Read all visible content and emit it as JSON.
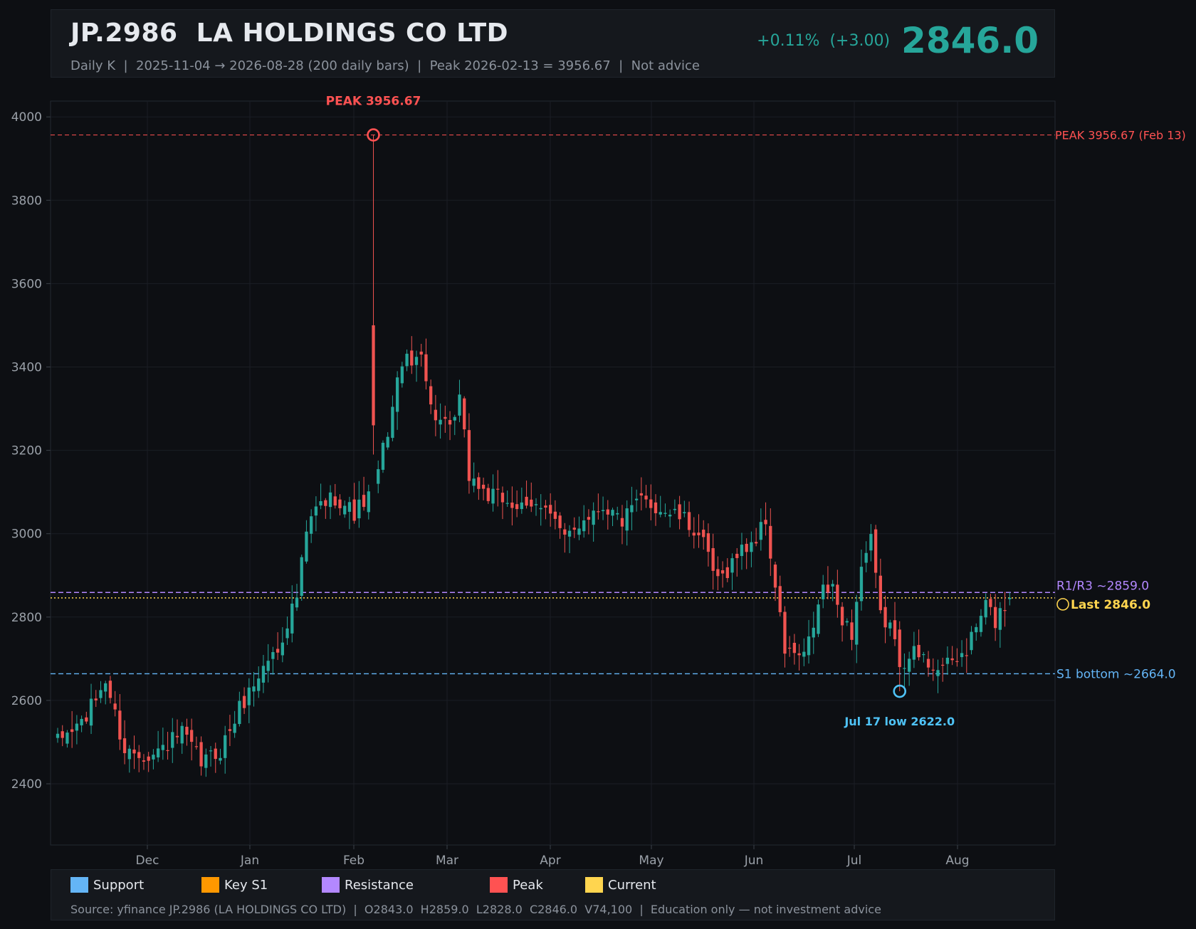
{
  "header": {
    "title": "JP.2986  LA HOLDINGS CO LTD",
    "subtitle": "Daily K  |  2025-11-04 → 2026-08-28 (200 daily bars)  |  Peak 2026-02-13 = 3956.67  |  Not advice",
    "change": "+0.11%  (+3.00)",
    "last_price": "2846.0"
  },
  "colors": {
    "up": "#26a69a",
    "down": "#ef5350",
    "peak": "#ff5252",
    "support": "#64b5f6",
    "key_s1": "#ff9800",
    "resistance": "#b388ff",
    "current": "#ffd54f",
    "low_marker": "#4fc3f7"
  },
  "legend": [
    {
      "label": "Support",
      "color": "#64b5f6"
    },
    {
      "label": "Key S1",
      "color": "#ff9800"
    },
    {
      "label": "Resistance",
      "color": "#b388ff"
    },
    {
      "label": "Peak",
      "color": "#ff5252"
    },
    {
      "label": "Current",
      "color": "#ffd54f"
    }
  ],
  "source": "Source: yfinance JP.2986 (LA HOLDINGS CO LTD)  |  O2843.0  H2859.0  L2828.0  C2846.0  V74,100  |  Education only — not investment advice",
  "chart_data": {
    "type": "candlestick",
    "y_ticks": [
      2400,
      2600,
      2800,
      3000,
      3200,
      3400,
      3600,
      3800,
      4000
    ],
    "ylim": [
      2250,
      4040
    ],
    "x_ticks": [
      "Dec",
      "Jan",
      "Feb",
      "Mar",
      "Apr",
      "May",
      "Jun",
      "Jul",
      "Aug"
    ],
    "grid": true,
    "levels": {
      "peak": {
        "value": 3956.67,
        "label": "PEAK 3956.67 (Feb 13)"
      },
      "resistance": {
        "value": 2859.0,
        "label": "R1/R3 ~2859.0"
      },
      "current": {
        "value": 2846.0,
        "label": "Last 2846.0"
      },
      "support": {
        "value": 2664.0,
        "label": "S1 bottom ~2664.0"
      }
    },
    "annotations": {
      "peak_text": "PEAK 3956.67",
      "peak_value": 3956.67,
      "low_text": "Jul 17 low 2622.0",
      "low_value": 2622.0
    },
    "anchors": [
      [
        0,
        2500
      ],
      [
        6,
        2560
      ],
      [
        10,
        2650
      ],
      [
        14,
        2480
      ],
      [
        20,
        2470
      ],
      [
        26,
        2520
      ],
      [
        30,
        2450
      ],
      [
        34,
        2480
      ],
      [
        38,
        2580
      ],
      [
        44,
        2700
      ],
      [
        46,
        2720
      ],
      [
        48,
        2790
      ],
      [
        50,
        2850
      ],
      [
        52,
        3000
      ],
      [
        54,
        3060
      ],
      [
        58,
        3090
      ],
      [
        62,
        3050
      ],
      [
        66,
        3100
      ],
      [
        70,
        3300
      ],
      [
        72,
        3420
      ],
      [
        74,
        3400
      ],
      [
        76,
        3450
      ],
      [
        78,
        3300
      ],
      [
        82,
        3240
      ],
      [
        84,
        3320
      ],
      [
        86,
        3140
      ],
      [
        90,
        3090
      ],
      [
        94,
        3080
      ],
      [
        98,
        3050
      ],
      [
        102,
        3080
      ],
      [
        106,
        2980
      ],
      [
        110,
        3040
      ],
      [
        114,
        3070
      ],
      [
        118,
        3030
      ],
      [
        122,
        3080
      ],
      [
        126,
        3060
      ],
      [
        130,
        3040
      ],
      [
        134,
        3000
      ],
      [
        138,
        2880
      ],
      [
        142,
        2950
      ],
      [
        146,
        2990
      ],
      [
        148,
        3030
      ],
      [
        150,
        2870
      ],
      [
        152,
        2720
      ],
      [
        156,
        2700
      ],
      [
        158,
        2780
      ],
      [
        160,
        2870
      ],
      [
        162,
        2860
      ],
      [
        164,
        2800
      ],
      [
        166,
        2760
      ],
      [
        168,
        2920
      ],
      [
        170,
        2980
      ],
      [
        172,
        2800
      ],
      [
        174,
        2780
      ],
      [
        176,
        2680
      ],
      [
        178,
        2720
      ],
      [
        182,
        2690
      ],
      [
        186,
        2680
      ],
      [
        190,
        2720
      ],
      [
        194,
        2830
      ],
      [
        196,
        2790
      ],
      [
        198,
        2830
      ],
      [
        199,
        2846
      ]
    ],
    "last_bar": {
      "open": 2843.0,
      "high": 2859.0,
      "low": 2828.0,
      "close": 2846.0
    }
  }
}
